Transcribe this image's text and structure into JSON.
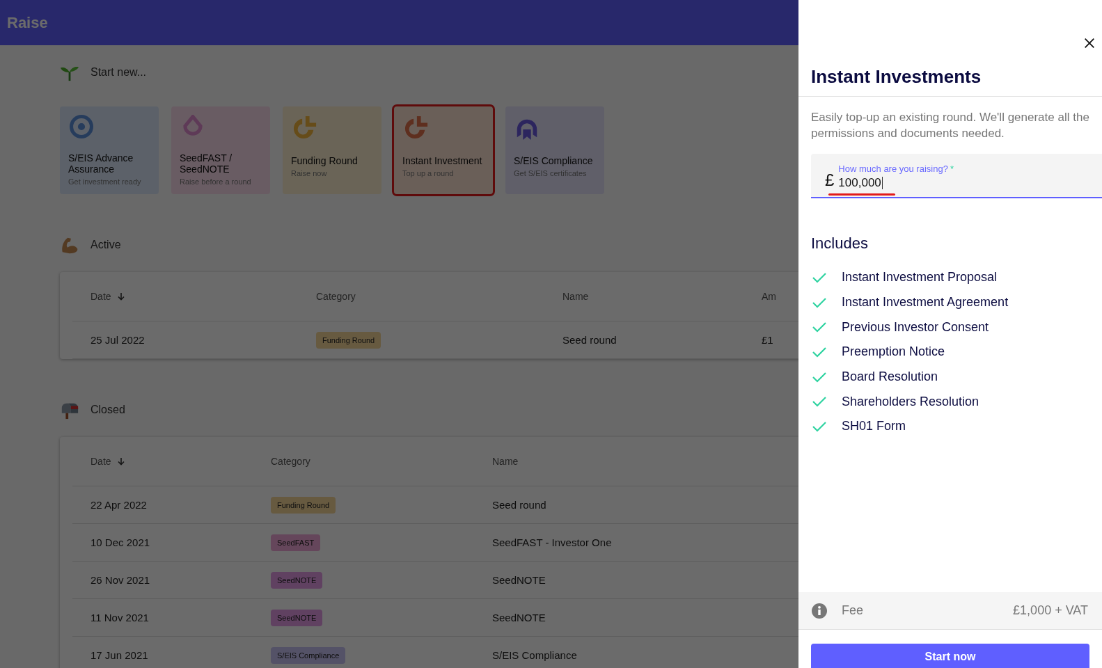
{
  "app_bar": {
    "title": "Raise"
  },
  "start_new": {
    "title": "Start new...",
    "cards": [
      {
        "title": "S/EIS Advance Assurance",
        "subtitle": "Get investment ready",
        "kind": "assurance",
        "highlighted": false
      },
      {
        "title": "SeedFAST / SeedNOTE",
        "subtitle": "Raise before a round",
        "kind": "seed",
        "highlighted": false
      },
      {
        "title": "Funding Round",
        "subtitle": "Raise now",
        "kind": "funding",
        "highlighted": false
      },
      {
        "title": "Instant Investment",
        "subtitle": "Top up a round",
        "kind": "instant",
        "highlighted": true
      },
      {
        "title": "S/EIS Compliance",
        "subtitle": "Get S/EIS certificates",
        "kind": "compliance",
        "highlighted": false
      }
    ]
  },
  "active": {
    "title": "Active",
    "columns": [
      {
        "label": "Date",
        "sorted": true
      },
      {
        "label": "Category",
        "sorted": false
      },
      {
        "label": "Name",
        "sorted": false
      },
      {
        "label": "Am",
        "sorted": false
      }
    ],
    "rows": [
      {
        "date": "25 Jul 2022",
        "category": "Funding Round",
        "kind": "funding",
        "name": "Seed round",
        "amount": "£1"
      }
    ]
  },
  "closed": {
    "title": "Closed",
    "columns": [
      {
        "label": "Date",
        "sorted": true
      },
      {
        "label": "Category",
        "sorted": false
      },
      {
        "label": "Name",
        "sorted": false
      }
    ],
    "rows": [
      {
        "date": "22 Apr 2022",
        "category": "Funding Round",
        "kind": "funding",
        "name": "Seed round"
      },
      {
        "date": "10 Dec 2021",
        "category": "SeedFAST",
        "kind": "seedfast",
        "name": "SeedFAST - Investor One"
      },
      {
        "date": "26 Nov 2021",
        "category": "SeedNOTE",
        "kind": "seednote",
        "name": "SeedNOTE"
      },
      {
        "date": "11 Nov 2021",
        "category": "SeedNOTE",
        "kind": "seednote",
        "name": "SeedNOTE"
      },
      {
        "date": "17 Jun 2021",
        "category": "S/EIS Compliance",
        "kind": "compliance",
        "name": "S/EIS Compliance"
      }
    ]
  },
  "drawer": {
    "title": "Instant Investments",
    "description": "Easily top-up an existing round. We'll generate all the permissions and documents needed.",
    "field": {
      "label": "How much are you raising?",
      "required_mark": "*",
      "prefix": "£",
      "value": "100,000",
      "annotated": true
    },
    "includes_title": "Includes",
    "includes": [
      "Instant Investment Proposal",
      "Instant Investment Agreement",
      "Previous Investor Consent",
      "Preemption Notice",
      "Board Resolution",
      "Shareholders Resolution",
      "SH01 Form"
    ],
    "fee": {
      "label": "Fee",
      "value": "£1,000 + VAT"
    },
    "button": "Start now"
  }
}
